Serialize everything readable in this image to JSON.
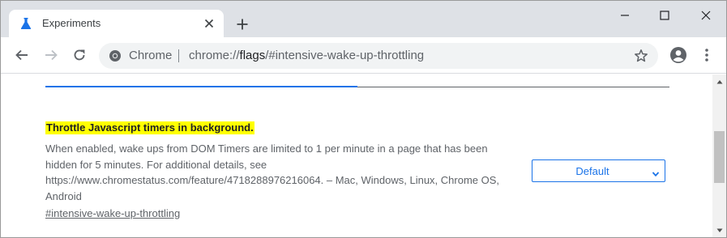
{
  "tab": {
    "title": "Experiments",
    "icon": "flask-icon"
  },
  "window_controls": {
    "minimize": "minimize-icon",
    "maximize": "maximize-icon",
    "close": "close-icon"
  },
  "omnibox": {
    "chip": "Chrome",
    "url_prefix": "chrome://",
    "url_host": "flags",
    "url_path": "/#intensive-wake-up-throttling"
  },
  "flag": {
    "title": "Throttle Javascript timers in background.",
    "description": "When enabled, wake ups from DOM Timers are limited to 1 per minute in a page that has been hidden for 5 minutes. For additional details, see https://www.chromestatus.com/feature/4718288976216064. – Mac, Windows, Linux, Chrome OS, Android",
    "link": "#intensive-wake-up-throttling",
    "selected": "Default"
  },
  "colors": {
    "accent": "#1a73e8",
    "highlight": "#ffff00",
    "tabstrip": "#dee1e6"
  }
}
